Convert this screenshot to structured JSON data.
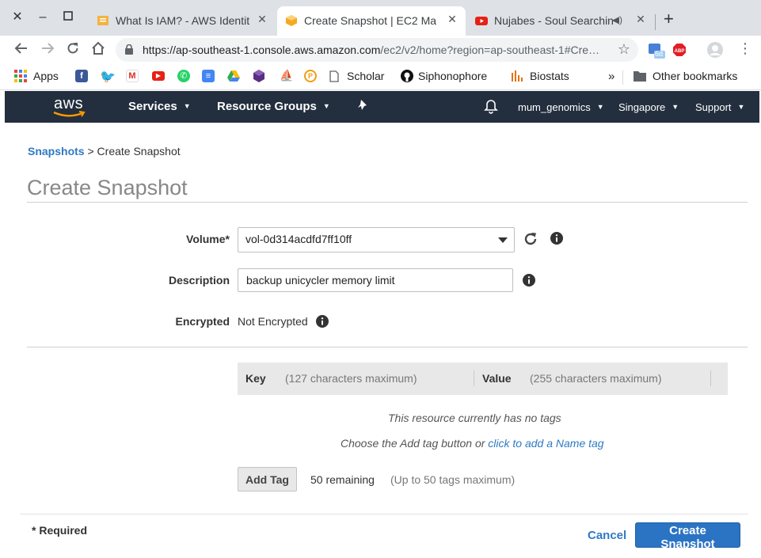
{
  "browser": {
    "tabs": [
      {
        "title": "What Is IAM? - AWS Identit",
        "icon": "aws-docs-icon"
      },
      {
        "title": "Create Snapshot | EC2 Ma",
        "icon": "aws-console-icon"
      },
      {
        "title": "Nujabes - Soul Searchin",
        "icon": "youtube-icon"
      }
    ],
    "url_host": "https://ap-southeast-1.console.aws.amazon.com",
    "url_rest": "/ec2/v2/home?region=ap-southeast-1#Cre…",
    "extension_badge": "6d",
    "bookmarks": {
      "apps": "Apps",
      "scholar": "Scholar",
      "siphonophore": "Siphonophore",
      "biostats": "Biostats",
      "overflow": "»",
      "other": "Other bookmarks"
    }
  },
  "aws_nav": {
    "logo": "aws",
    "services": "Services",
    "resource_groups": "Resource Groups",
    "account": "mum_genomics",
    "region": "Singapore",
    "support": "Support"
  },
  "page": {
    "breadcrumb_link": "Snapshots",
    "breadcrumb_sep": ">",
    "breadcrumb_current": "Create Snapshot",
    "title": "Create Snapshot"
  },
  "form": {
    "volume_label": "Volume*",
    "volume_value": "vol-0d314acdfd7ff10ff",
    "description_label": "Description",
    "description_value": "backup unicycler memory limit",
    "encrypted_label": "Encrypted",
    "encrypted_value": "Not Encrypted"
  },
  "tags": {
    "key_label": "Key",
    "key_hint": "(127 characters maximum)",
    "value_label": "Value",
    "value_hint": "(255 characters maximum)",
    "empty_message": "This resource currently has no tags",
    "help_prefix": "Choose the Add tag button or",
    "help_link": "click to add a Name tag",
    "add_button": "Add Tag",
    "remaining": "50 remaining",
    "maximum": "(Up to 50 tags maximum)"
  },
  "footer": {
    "required_note": "* Required",
    "cancel": "Cancel",
    "submit": "Create Snapshot"
  },
  "colors": {
    "aws_nav_bg": "#232f3e",
    "link_blue": "#2e7ac3",
    "primary_button": "#2b74c4",
    "aws_orange": "#ff9900"
  }
}
